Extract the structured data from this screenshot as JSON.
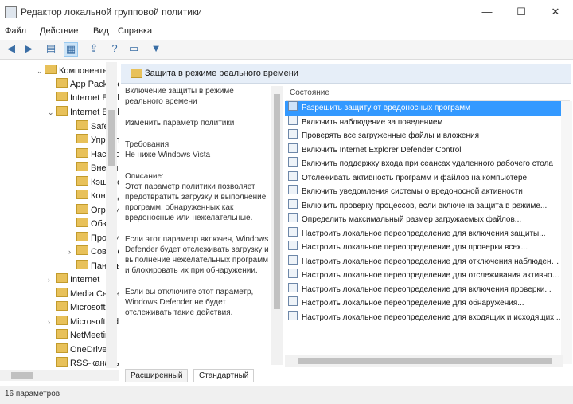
{
  "window": {
    "title": "Редактор локальной групповой политики",
    "minimize": "—",
    "maximize": "☐",
    "close": "✕"
  },
  "menu": [
    "Файл",
    "Действие",
    "Вид",
    "Справка"
  ],
  "toolbar": {
    "icons": [
      "back-arrow-icon",
      "forward-arrow-icon",
      "up-folder-icon",
      "show-hide-tree-icon",
      "export-icon",
      "help-icon",
      "properties-icon",
      "filter-icon"
    ]
  },
  "tree": {
    "rows": [
      {
        "label": "Компоненты",
        "expanded": true
      },
      {
        "label": "App Package"
      },
      {
        "label": "Internet Explorer"
      },
      {
        "label": "Internet Explorer",
        "expanded": true
      },
      {
        "label": "Safety"
      },
      {
        "label": "Управление"
      },
      {
        "label": "Настройки"
      },
      {
        "label": "Внешний вид"
      },
      {
        "label": "Кэширование"
      },
      {
        "label": "Конфиденциальность"
      },
      {
        "label": "Ограничения"
      },
      {
        "label": "Обзор"
      },
      {
        "label": "Прокси"
      },
      {
        "label": "Совместимость"
      },
      {
        "label": "Панель"
      },
      {
        "label": "Internet"
      },
      {
        "label": "Media Center"
      },
      {
        "label": "Microsoft"
      },
      {
        "label": "Microsoft Edge"
      },
      {
        "label": "NetMeeting"
      },
      {
        "label": "OneDrive"
      },
      {
        "label": "RSS-каналы"
      }
    ]
  },
  "pane": {
    "header": "Защита в режиме реального времени",
    "description": [
      "Включение защиты в режиме реального времени",
      "Изменить параметр политики",
      "Требования:\nНе ниже Windows Vista",
      "Описание:\nЭтот параметр политики позволяет предотвратить загрузку и выполнение программ, обнаруженных как вредоносные или нежелательные.",
      "Если этот параметр включен, Windows Defender будет отслеживать загрузку и выполнение нежелательных программ и блокировать их при обнаружении.",
      "Если вы отключите этот параметр, Windows Defender не будет отслеживать такие действия."
    ],
    "column_header": "Состояние",
    "items": [
      "Разрешить защиту от вредоносных программ",
      "Включить наблюдение за поведением",
      "Проверять все загруженные файлы и вложения",
      "Включить Internet Explorer Defender Control",
      "Включить поддержку входа при сеансах удаленного рабочего стола",
      "Отслеживать активность программ и файлов на компьютере",
      "Включить уведомления системы о вредоносной активности",
      "Включить проверку процессов, если включена защита в режиме...",
      "Определить максимальный размер загружаемых файлов...",
      "Настроить локальное переопределение для включения защиты...",
      "Настроить локальное переопределение для проверки всех...",
      "Настроить локальное переопределение для отключения наблюдения...",
      "Настроить локальное переопределение для отслеживания активности...",
      "Настроить локальное переопределение для включения проверки...",
      "Настроить локальное переопределение для обнаружения...",
      "Настроить локальное переопределение для входящих и исходящих..."
    ],
    "selected_index": 0
  },
  "tabs": [
    "Расширенный",
    "Стандартный"
  ],
  "status": "16 параметров"
}
